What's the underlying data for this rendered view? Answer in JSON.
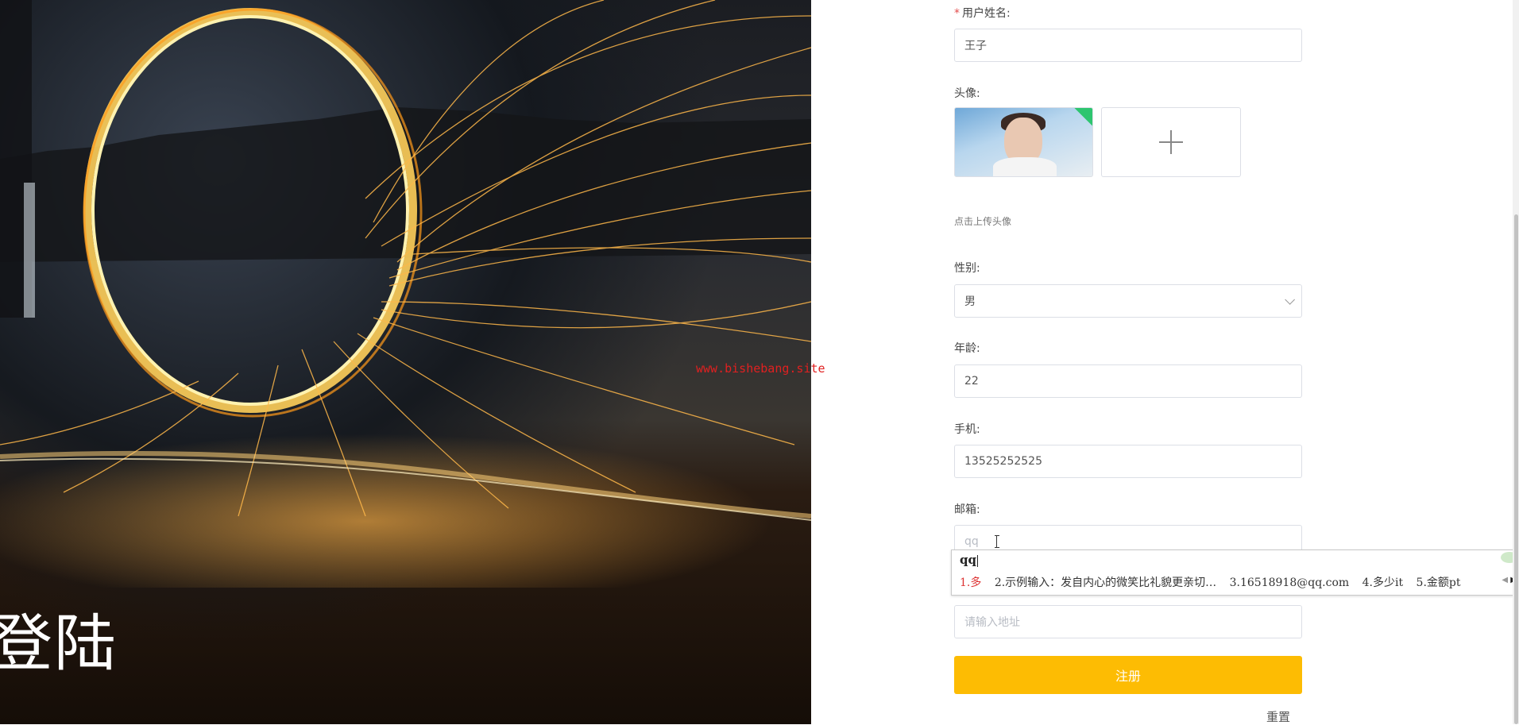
{
  "hero": {
    "title": "登陆",
    "watermark": "www.bishebang.site"
  },
  "form": {
    "username": {
      "label": "用户姓名:",
      "required_mark": "*",
      "value": "王子"
    },
    "avatar": {
      "label": "头像:",
      "hint": "点击上传头像"
    },
    "gender": {
      "label": "性别:",
      "value": "男"
    },
    "age": {
      "label": "年龄:",
      "value": "22"
    },
    "phone": {
      "label": "手机:",
      "value": "13525252525"
    },
    "email": {
      "label": "邮箱:",
      "value": "qq"
    },
    "address": {
      "placeholder": "请输入地址"
    },
    "submit_label": "注册",
    "reset_label": "重置"
  },
  "ime": {
    "composition": "qq",
    "candidates": [
      "1.多",
      "2.示例输入：发自内心的微笑比礼貌更亲切…",
      "3.16518918@qq.com",
      "4.多少it",
      "5.金额pt"
    ]
  },
  "colors": {
    "accent": "#fdbc03",
    "required": "#e34d4d",
    "watermark": "#e02020"
  }
}
